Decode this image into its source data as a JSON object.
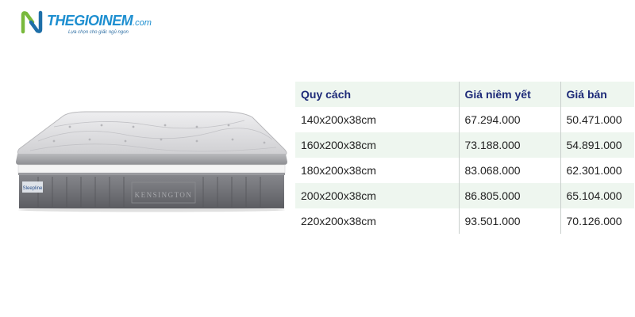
{
  "logo": {
    "brand": "THEGIOINEM",
    "domain_suffix": ".com",
    "tagline": "Lựa chọn cho giấc ngủ ngon",
    "colors": {
      "mark_green": "#79b93c",
      "mark_blue": "#1e6fa8",
      "wordmark": "#1e8fd0"
    }
  },
  "product_image": {
    "icon": "mattress-image",
    "brand_label": "Sleepline",
    "model_label": "KENSINGTON",
    "colors": {
      "top": "#dcdcde",
      "side": "#6f7075",
      "band": "#f4f4f4"
    }
  },
  "price_table": {
    "headers": {
      "spec": "Quy cách",
      "list_price": "Giá niêm yết",
      "sale_price": "Giá bán"
    },
    "rows": [
      {
        "spec": "140x200x38cm",
        "list_price": "67.294.000",
        "sale_price": "50.471.000"
      },
      {
        "spec": "160x200x38cm",
        "list_price": "73.188.000",
        "sale_price": "54.891.000"
      },
      {
        "spec": "180x200x38cm",
        "list_price": "83.068.000",
        "sale_price": "62.301.000"
      },
      {
        "spec": "200x200x38cm",
        "list_price": "86.805.000",
        "sale_price": "65.104.000"
      },
      {
        "spec": "220x200x38cm",
        "list_price": "93.501.000",
        "sale_price": "70.126.000"
      }
    ],
    "colors": {
      "header_text": "#1d2a78",
      "stripe": "#eef6ef",
      "divider": "#c9cfcc"
    }
  }
}
